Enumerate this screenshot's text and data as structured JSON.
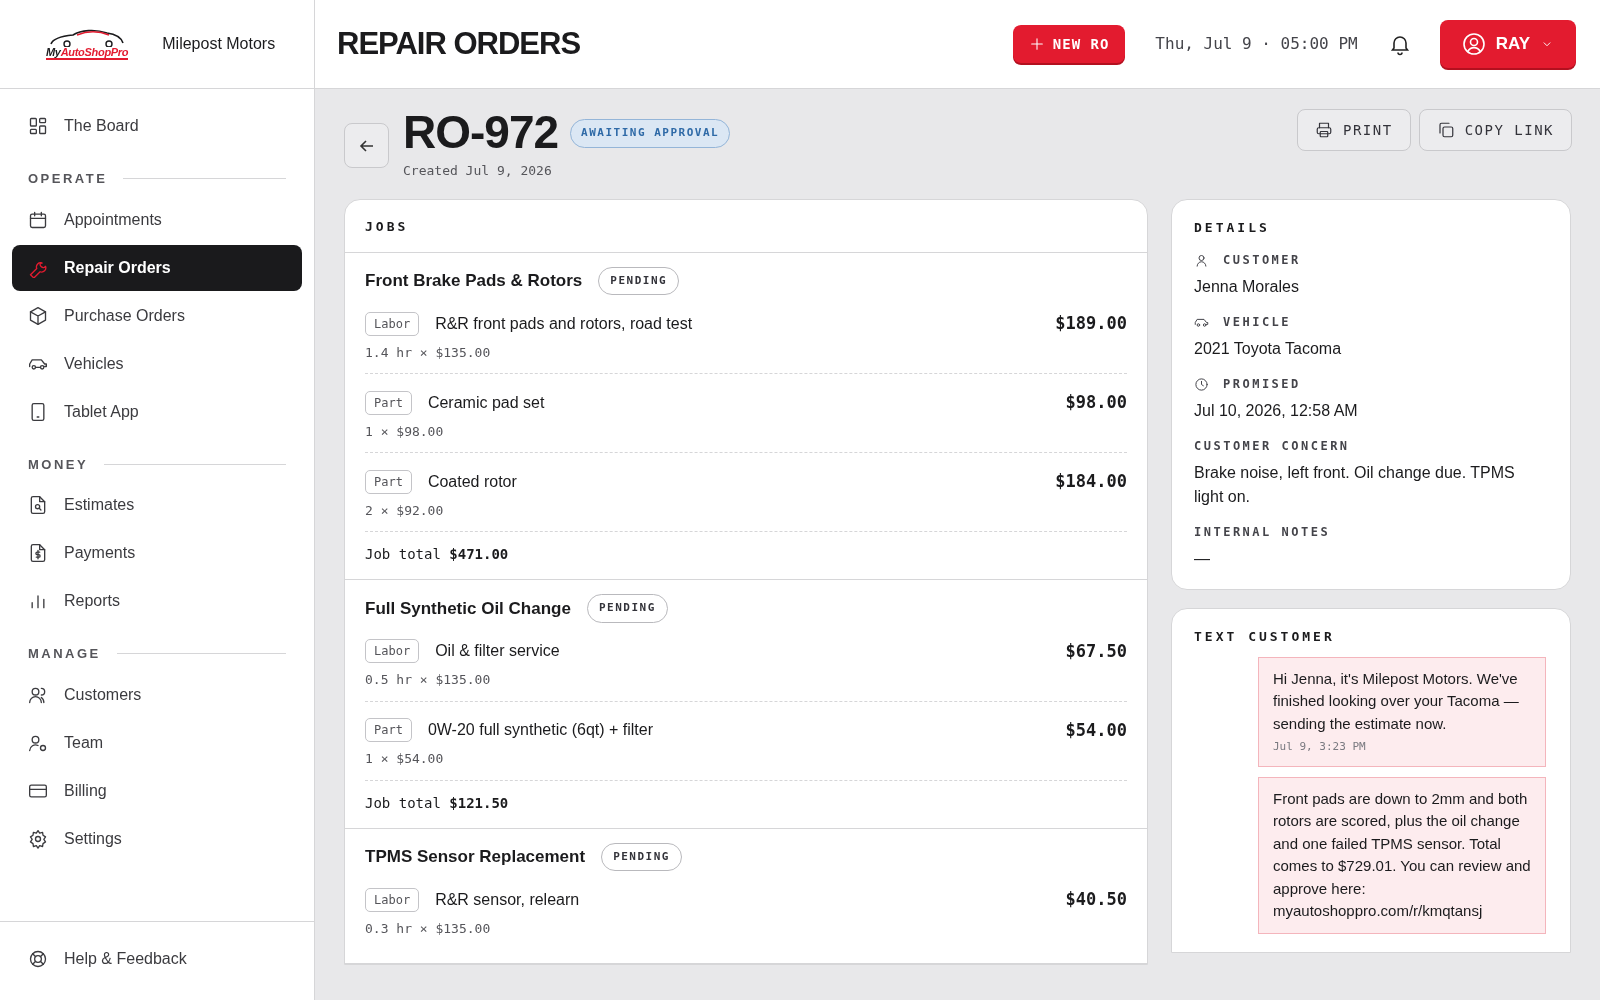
{
  "sidebar": {
    "logo": {
      "part_1": "My",
      "part_2": "AutoShopPro"
    },
    "brand": "Milepost Motors",
    "sections": [
      {
        "items": [
          {
            "label": "The Board",
            "selected": false
          }
        ]
      },
      {
        "heading": "OPERATE",
        "items": [
          {
            "label": "Appointments",
            "selected": false
          },
          {
            "label": "Repair Orders",
            "selected": true
          },
          {
            "label": "Purchase Orders",
            "selected": false
          },
          {
            "label": "Vehicles",
            "selected": false
          },
          {
            "label": "Tablet App",
            "selected": false
          }
        ]
      },
      {
        "heading": "MONEY",
        "items": [
          {
            "label": "Estimates",
            "selected": false
          },
          {
            "label": "Payments",
            "selected": false
          },
          {
            "label": "Reports",
            "selected": false
          }
        ]
      },
      {
        "heading": "MANAGE",
        "items": [
          {
            "label": "Customers",
            "selected": false
          },
          {
            "label": "Team",
            "selected": false
          },
          {
            "label": "Billing",
            "selected": false
          },
          {
            "label": "Settings",
            "selected": false
          }
        ]
      }
    ],
    "footer_item": {
      "label": "Help & Feedback",
      "selected": false
    }
  },
  "header": {
    "title": "REPAIR ORDERS",
    "new_button": "NEW RO",
    "datetime": "Thu, Jul 9 · 05:00 PM",
    "user": "RAY"
  },
  "order": {
    "number": "RO-972",
    "status": "AWAITING APPROVAL",
    "created": "Created Jul 9, 2026",
    "actions": [
      "PRINT",
      "COPY LINK"
    ]
  },
  "jobs": {
    "title": "JOBS",
    "items": [
      {
        "name": "Front Brake Pads & Rotors",
        "status": "PENDING",
        "lines": [
          {
            "type": "Labor",
            "description": "R&R front pads and rotors, road test",
            "detail": "1.4 hr × $135.00",
            "amount": "$189.00"
          },
          {
            "type": "Part",
            "description": "Ceramic pad set",
            "detail": "1 × $98.00",
            "amount": "$98.00"
          },
          {
            "type": "Part",
            "description": "Coated rotor",
            "detail": "2 × $92.00",
            "amount": "$184.00"
          }
        ],
        "total_label": "Job total",
        "total": "$471.00"
      },
      {
        "name": "Full Synthetic Oil Change",
        "status": "PENDING",
        "lines": [
          {
            "type": "Labor",
            "description": "Oil & filter service",
            "detail": "0.5 hr × $135.00",
            "amount": "$67.50"
          },
          {
            "type": "Part",
            "description": "0W-20 full synthetic (6qt) + filter",
            "detail": "1 × $54.00",
            "amount": "$54.00"
          }
        ],
        "total_label": "Job total",
        "total": "$121.50"
      },
      {
        "name": "TPMS Sensor Replacement",
        "status": "PENDING",
        "lines": [
          {
            "type": "Labor",
            "description": "R&R sensor, relearn",
            "detail": "0.3 hr × $135.00",
            "amount": "$40.50"
          }
        ]
      }
    ]
  },
  "details": {
    "title": "DETAILS",
    "fields": [
      {
        "label": "CUSTOMER",
        "value": "Jenna Morales"
      },
      {
        "label": "VEHICLE",
        "value": "2021 Toyota Tacoma"
      },
      {
        "label": "PROMISED",
        "value": "Jul 10, 2026, 12:58 AM"
      },
      {
        "label": "CUSTOMER CONCERN",
        "value": "Brake noise, left front. Oil change due. TPMS light on."
      },
      {
        "label": "INTERNAL NOTES",
        "value": "—"
      }
    ]
  },
  "text_customer": {
    "title": "TEXT CUSTOMER",
    "messages": [
      {
        "text": "Hi Jenna, it's Milepost Motors. We've finished looking over your Tacoma — sending the estimate now.",
        "time": "Jul 9, 3:23 PM"
      },
      {
        "text": "Front pads are down to 2mm and both rotors are scored, plus the oil change and one failed TPMS sensor. Total comes to $729.01. You can review and approve here: myautoshoppro.com/r/kmqtansj"
      }
    ]
  }
}
